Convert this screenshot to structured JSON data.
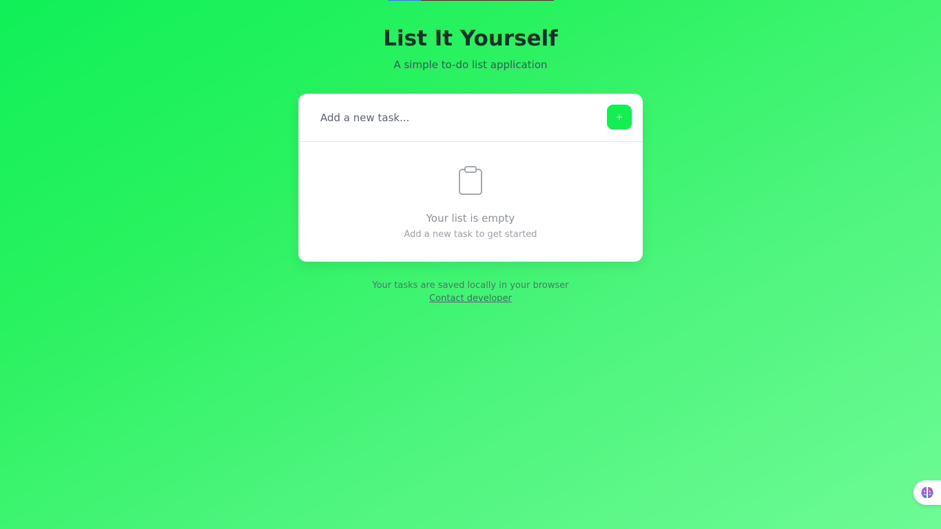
{
  "header": {
    "title": "List It Yourself",
    "subtitle": "A simple to-do list application"
  },
  "task_input": {
    "placeholder": "Add a new task...",
    "value": ""
  },
  "add_button": {
    "label": "+"
  },
  "empty_state": {
    "icon": "clipboard-icon",
    "title": "Your list is empty",
    "hint": "Add a new task to get started"
  },
  "footer": {
    "note": "Your tasks are saved locally in your browser",
    "link_label": "Contact developer"
  },
  "widget": {
    "icon": "brain-icon"
  },
  "colors": {
    "accent": "#10f050",
    "title": "#15322a",
    "card_background": "#ffffff"
  }
}
